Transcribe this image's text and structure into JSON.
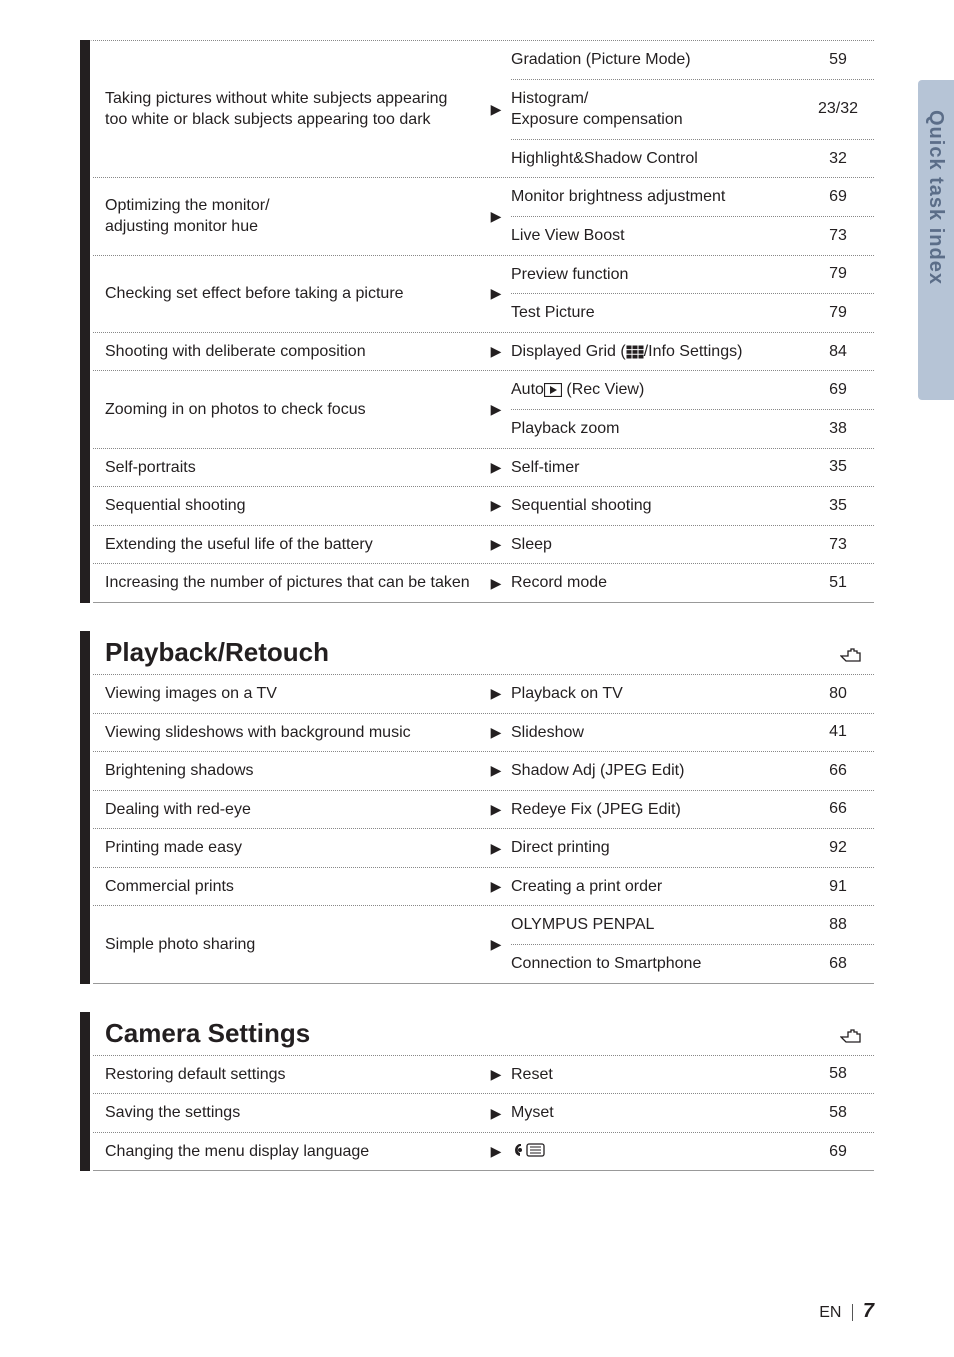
{
  "sideTab": "Quick task index",
  "footer": {
    "lang": "EN",
    "page": "7"
  },
  "icons": {
    "pointer": "☞",
    "grid": "grid",
    "play": "play",
    "langGlobe": "lang"
  },
  "shootCont": [
    {
      "left": "Taking pictures without white subjects appearing too white or black subjects appearing too dark",
      "subs": [
        {
          "label": "Gradation (Picture Mode)",
          "page": "59"
        },
        {
          "label": "Histogram/\nExposure compensation",
          "page": "23/32"
        },
        {
          "label": "Highlight&Shadow Control",
          "page": "32"
        }
      ]
    },
    {
      "left": "Optimizing the monitor/\nadjusting monitor hue",
      "subs": [
        {
          "label": "Monitor brightness adjustment",
          "page": "69"
        },
        {
          "label": "Live View Boost",
          "page": "73"
        }
      ]
    },
    {
      "left": "Checking set effect before taking a picture",
      "subs": [
        {
          "label": "Preview function",
          "page": "79"
        },
        {
          "label": "Test Picture",
          "page": "79"
        }
      ]
    },
    {
      "left": "Shooting with deliberate composition",
      "subs": [
        {
          "label": "Displayed Grid ({GRID}/Info Settings)",
          "page": "84"
        }
      ]
    },
    {
      "left": "Zooming in on photos to check focus",
      "subs": [
        {
          "label": "Auto{PLAY} (Rec View)",
          "page": "69"
        },
        {
          "label": "Playback zoom",
          "page": "38"
        }
      ]
    },
    {
      "left": "Self-portraits",
      "subs": [
        {
          "label": "Self-timer",
          "page": "35"
        }
      ]
    },
    {
      "left": "Sequential shooting",
      "subs": [
        {
          "label": "Sequential shooting",
          "page": "35"
        }
      ]
    },
    {
      "left": "Extending the useful life of the battery",
      "subs": [
        {
          "label": "Sleep",
          "page": "73"
        }
      ]
    },
    {
      "left": "Increasing the number of pictures that can be taken",
      "subs": [
        {
          "label": "Record mode",
          "page": "51"
        }
      ]
    }
  ],
  "playback": {
    "title": "Playback/Retouch",
    "rows": [
      {
        "left": "Viewing images on a TV",
        "subs": [
          {
            "label": "Playback on TV",
            "page": "80"
          }
        ]
      },
      {
        "left": "Viewing slideshows with background music",
        "subs": [
          {
            "label": "Slideshow",
            "page": "41"
          }
        ]
      },
      {
        "left": "Brightening shadows",
        "subs": [
          {
            "label": "Shadow Adj (JPEG Edit)",
            "page": "66"
          }
        ]
      },
      {
        "left": "Dealing with red-eye",
        "subs": [
          {
            "label": "Redeye Fix (JPEG Edit)",
            "page": "66"
          }
        ]
      },
      {
        "left": "Printing made easy",
        "subs": [
          {
            "label": "Direct printing",
            "page": "92"
          }
        ]
      },
      {
        "left": "Commercial prints",
        "subs": [
          {
            "label": "Creating a print order",
            "page": "91"
          }
        ]
      },
      {
        "left": "Simple photo sharing",
        "subs": [
          {
            "label": "OLYMPUS PENPAL",
            "page": "88"
          },
          {
            "label": "Connection to Smartphone",
            "page": "68"
          }
        ]
      }
    ]
  },
  "camera": {
    "title": "Camera Settings",
    "rows": [
      {
        "left": "Restoring default settings",
        "subs": [
          {
            "label": "Reset",
            "page": "58"
          }
        ]
      },
      {
        "left": "Saving the settings",
        "subs": [
          {
            "label": "Myset",
            "page": "58"
          }
        ]
      },
      {
        "left": "Changing the menu display language",
        "subs": [
          {
            "label": "{LANG}",
            "page": "69"
          }
        ]
      }
    ]
  }
}
